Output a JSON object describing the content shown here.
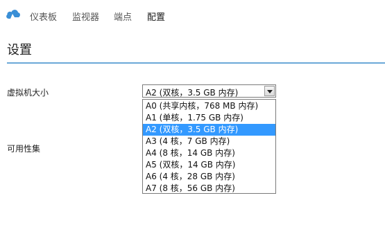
{
  "nav": {
    "logo_icon": "cloud-logo-icon",
    "items": [
      {
        "label": "仪表板",
        "active": false
      },
      {
        "label": "监视器",
        "active": false
      },
      {
        "label": "端点",
        "active": false
      },
      {
        "label": "配置",
        "active": true
      }
    ]
  },
  "page": {
    "title": "设置"
  },
  "form": {
    "vm_size": {
      "label": "虚拟机大小",
      "selected": "A2 (双核，3.5 GB 内存)",
      "options": [
        "A0 (共享内核，768 MB 内存)",
        "A1 (单核，1.75 GB 内存)",
        "A2 (双核，3.5 GB 内存)",
        "A3 (4 核，7 GB 内存)",
        "A4 (8 核，14 GB 内存)",
        "A5 (双核，14 GB 内存)",
        "A6 (4 核，28 GB 内存)",
        "A7 (8 核，56 GB 内存)"
      ],
      "highlighted_index": 2
    },
    "availability_set": {
      "label": "可用性集"
    }
  },
  "colors": {
    "accent": "#3399ff",
    "rule": "#6aa8d8",
    "logo": "#3a8fd6"
  }
}
